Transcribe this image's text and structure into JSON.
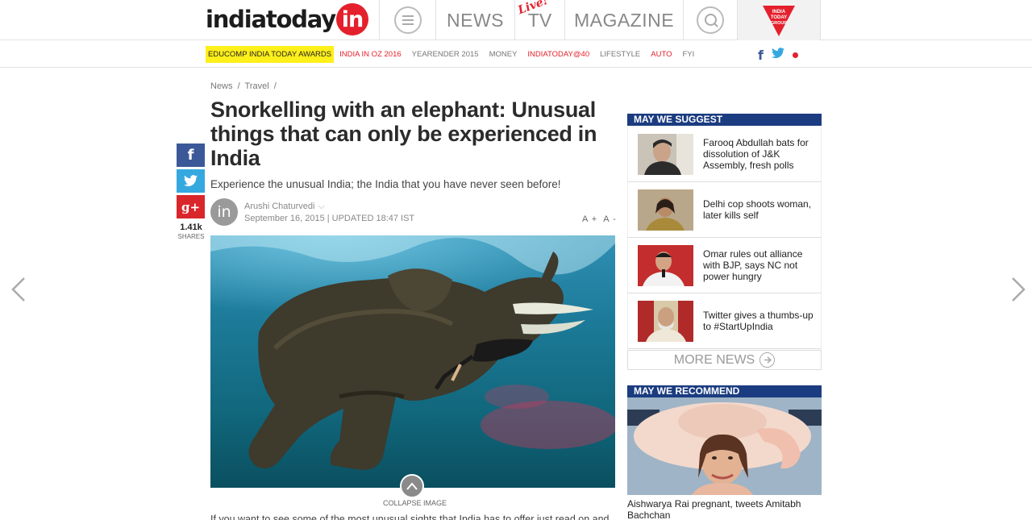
{
  "header": {
    "logo_text": "indiatoday",
    "logo_badge": "in",
    "nav": {
      "news": "NEWS",
      "tv": "TV",
      "live": "Live!",
      "magazine": "MAGAZINE"
    },
    "group_logo_text": [
      "INDIA",
      "TODAY",
      "GROUP"
    ],
    "icons": [
      "menu-icon",
      "search-icon",
      "india-today-group-logo"
    ]
  },
  "subnav": {
    "items": [
      {
        "label": "EDUCOMP INDIA TODAY AWARDS",
        "style": "highlight"
      },
      {
        "label": "INDIA IN OZ 2016",
        "style": "red"
      },
      {
        "label": "YEARENDER 2015",
        "style": "normal"
      },
      {
        "label": "MONEY",
        "style": "normal"
      },
      {
        "label": "INDIATODAY@40",
        "style": "red"
      },
      {
        "label": "LIFESTYLE",
        "style": "normal"
      },
      {
        "label": "AUTO",
        "style": "red"
      },
      {
        "label": "FYI",
        "style": "normal"
      }
    ],
    "social": {
      "facebook": "f"
    }
  },
  "share": {
    "count": "1.41k",
    "label": "SHARES",
    "facebook": "f",
    "googleplus": "g+"
  },
  "article": {
    "breadcrumb": [
      "News",
      "/",
      "Travel",
      "/"
    ],
    "headline": "Snorkelling with an elephant: Unusual things that can only be experienced in India",
    "kicker": "Experience the unusual India; the India that you have never seen before!",
    "author_initials": "in",
    "author": "Arushi Chaturvedi",
    "date": "September 16, 2015 | UPDATED 18:47 IST",
    "font_ctrl": {
      "increase": "A +",
      "decrease": "A -"
    },
    "collapse_label": "COLLAPSE IMAGE",
    "body_start": "If you want to see some of the most unusual sights that India has to offer just read on and"
  },
  "sidebar": {
    "suggest_title": "MAY WE SUGGEST",
    "suggestions": [
      {
        "title": "Farooq Abdullah bats for dissolution of J&K Assembly, fresh polls"
      },
      {
        "title": "Delhi cop shoots woman, later kills self"
      },
      {
        "title": "Omar rules out alliance with BJP, says NC not power hungry"
      },
      {
        "title": "Twitter gives a thumbs-up to #StartUpIndia"
      }
    ],
    "more_news": "MORE NEWS",
    "recommend_title": "MAY WE RECOMMEND",
    "recommend_caption": "Aishwarya Rai pregnant, tweets Amitabh Bachchan"
  },
  "colors": {
    "brand_red": "#e4202c",
    "widget_blue": "#1b3c80",
    "highlight_yellow": "#ffef1a",
    "facebook_blue": "#3b5998",
    "twitter_blue": "#35a8e0"
  }
}
